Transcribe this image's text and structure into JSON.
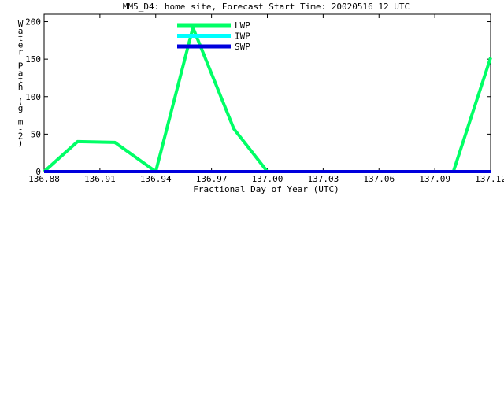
{
  "chart_data": {
    "type": "line",
    "title": "MM5_D4: home site,  Forecast Start Time: 20020516 12 UTC",
    "xlabel": "Fractional Day of Year (UTC)",
    "ylabel": "Water Path (g m-2)",
    "ylabel_chars": [
      "W",
      "a",
      "t",
      "e",
      "r",
      " ",
      "P",
      "a",
      "t",
      "h",
      " ",
      "(",
      "g",
      " ",
      "m",
      "-",
      "2",
      ")"
    ],
    "xlim": [
      136.88,
      137.12
    ],
    "ylim": [
      0,
      210
    ],
    "x_ticks": [
      136.88,
      136.91,
      136.94,
      136.97,
      137.0,
      137.03,
      137.06,
      137.09,
      137.12
    ],
    "x_tick_labels": [
      "136.88",
      "136.91",
      "136.94",
      "136.97",
      "137.00",
      "137.03",
      "137.06",
      "137.09",
      "137.12"
    ],
    "y_ticks": [
      0,
      50,
      100,
      150,
      200
    ],
    "y_tick_labels": [
      "0",
      "50",
      "100",
      "150",
      "200"
    ],
    "legend_position": "top-center",
    "series": [
      {
        "name": "LWP",
        "color": "#00ff66",
        "x": [
          136.88,
          136.898,
          136.918,
          136.94,
          136.96,
          136.982,
          137.0,
          137.02,
          137.04,
          137.06,
          137.08,
          137.1,
          137.12
        ],
        "y": [
          0,
          40,
          39,
          0,
          192,
          57,
          0,
          0,
          0,
          0,
          0,
          0,
          152
        ]
      },
      {
        "name": "IWP",
        "color": "#00ffff",
        "x": [
          136.88,
          136.9,
          136.92,
          136.94,
          136.96,
          136.98,
          137.0,
          137.02,
          137.04,
          137.06,
          137.08,
          137.1,
          137.12
        ],
        "y": [
          0,
          0,
          0,
          0,
          0,
          0,
          0,
          0,
          0,
          0,
          0,
          0,
          0
        ]
      },
      {
        "name": "SWP",
        "color": "#0000dd",
        "x": [
          136.88,
          136.9,
          136.92,
          136.94,
          136.96,
          136.98,
          137.0,
          137.02,
          137.04,
          137.06,
          137.08,
          137.1,
          137.12
        ],
        "y": [
          0,
          0,
          0,
          0,
          0,
          0,
          0,
          0,
          0,
          0,
          0,
          0,
          0
        ]
      }
    ]
  }
}
